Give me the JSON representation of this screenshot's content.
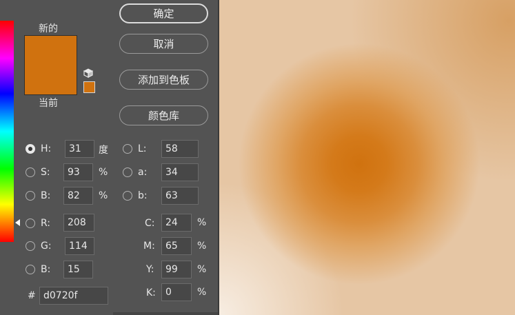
{
  "colors": {
    "new": "#d0720f",
    "current": "#d0720f"
  },
  "labels": {
    "new": "新的",
    "current": "当前",
    "hash": "#"
  },
  "buttons": {
    "ok": "确定",
    "cancel": "取消",
    "add_to_swatches": "添加到色板",
    "color_libraries": "颜色库"
  },
  "hsb": {
    "h": {
      "label": "H:",
      "value": "31",
      "unit": "度"
    },
    "s": {
      "label": "S:",
      "value": "93",
      "unit": "%"
    },
    "b": {
      "label": "B:",
      "value": "82",
      "unit": "%"
    }
  },
  "lab": {
    "l": {
      "label": "L:",
      "value": "58"
    },
    "a": {
      "label": "a:",
      "value": "34"
    },
    "b": {
      "label": "b:",
      "value": "63"
    }
  },
  "rgb": {
    "r": {
      "label": "R:",
      "value": "208"
    },
    "g": {
      "label": "G:",
      "value": "114"
    },
    "b": {
      "label": "B:",
      "value": "15"
    }
  },
  "cmyk": {
    "c": {
      "label": "C:",
      "value": "24",
      "unit": "%"
    },
    "m": {
      "label": "M:",
      "value": "65",
      "unit": "%"
    },
    "y": {
      "label": "Y:",
      "value": "99",
      "unit": "%"
    },
    "k": {
      "label": "K:",
      "value": "0",
      "unit": "%"
    }
  },
  "hex": "d0720f",
  "icons": {
    "cube": "cube-icon",
    "radio": "radio-icon"
  }
}
